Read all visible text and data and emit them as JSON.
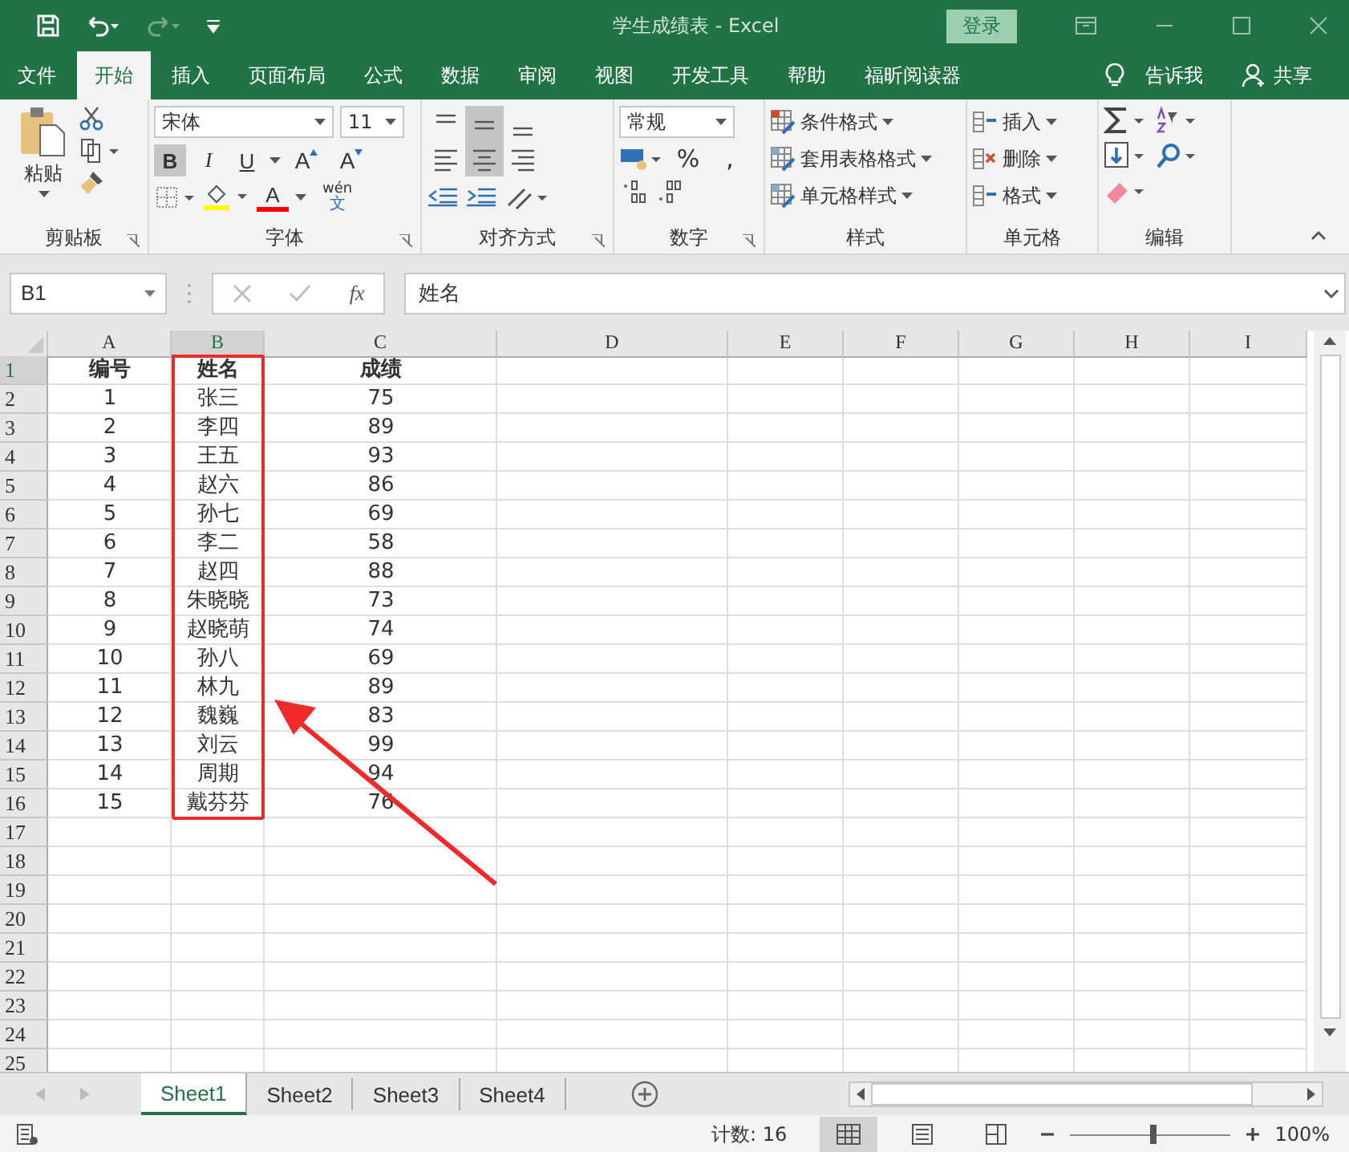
{
  "title_bar": {
    "title": "学生成绩表  -  Excel",
    "login": "登录"
  },
  "menu_tabs": [
    {
      "label": "文件",
      "selected": false
    },
    {
      "label": "开始",
      "selected": true
    },
    {
      "label": "插入",
      "selected": false
    },
    {
      "label": "页面布局",
      "selected": false
    },
    {
      "label": "公式",
      "selected": false
    },
    {
      "label": "数据",
      "selected": false
    },
    {
      "label": "审阅",
      "selected": false
    },
    {
      "label": "视图",
      "selected": false
    },
    {
      "label": "开发工具",
      "selected": false
    },
    {
      "label": "帮助",
      "selected": false
    },
    {
      "label": "福昕阅读器",
      "selected": false
    }
  ],
  "tell_me": "告诉我",
  "share": "共享",
  "ribbon": {
    "clipboard": {
      "paste": "粘贴",
      "label": "剪贴板"
    },
    "font": {
      "font_name": "宋体",
      "font_size": "11",
      "buttons": [
        {
          "label": "B",
          "pressed": true
        },
        {
          "label": "I",
          "pressed": false
        },
        {
          "label": "U",
          "pressed": false
        }
      ],
      "grow": "A",
      "shrink": "A",
      "font_color_letter": "A",
      "phonetic": "wén",
      "phonetic_char": "文",
      "label": "字体"
    },
    "alignment": {
      "buttons": [
        {
          "kind": "top",
          "pressed": false
        },
        {
          "kind": "middle",
          "pressed": true
        },
        {
          "kind": "bottom",
          "pressed": false
        },
        {
          "kind": "left",
          "pressed": false
        },
        {
          "kind": "center",
          "pressed": true
        },
        {
          "kind": "right",
          "pressed": false
        }
      ],
      "label": "对齐方式"
    },
    "number": {
      "format": "常规",
      "percent": "%",
      "comma": ",",
      "label": "数字"
    },
    "styles": {
      "items": [
        "条件格式",
        "套用表格格式",
        "单元格样式"
      ],
      "label": "样式"
    },
    "cells": {
      "items": [
        "插入",
        "删除",
        "格式"
      ],
      "label": "单元格"
    },
    "editing": {
      "label": "编辑"
    }
  },
  "formula_bar": {
    "name_box": "B1",
    "fx": "fx",
    "value": "姓名"
  },
  "sheet": {
    "columns": [
      {
        "label": "A",
        "selected": false
      },
      {
        "label": "B",
        "selected": true
      },
      {
        "label": "C",
        "selected": false
      },
      {
        "label": "D",
        "selected": false
      },
      {
        "label": "E",
        "selected": false
      },
      {
        "label": "F",
        "selected": false
      },
      {
        "label": "G",
        "selected": false
      },
      {
        "label": "H",
        "selected": false
      },
      {
        "label": "I",
        "selected": false
      }
    ],
    "rows": [
      {
        "number": "1",
        "selected": true,
        "bold": true,
        "cells": [
          "编号",
          "姓名",
          "成绩"
        ]
      },
      {
        "number": "2",
        "selected": false,
        "bold": false,
        "cells": [
          "1",
          "张三",
          "75"
        ]
      },
      {
        "number": "3",
        "selected": false,
        "bold": false,
        "cells": [
          "2",
          "李四",
          "89"
        ]
      },
      {
        "number": "4",
        "selected": false,
        "bold": false,
        "cells": [
          "3",
          "王五",
          "93"
        ]
      },
      {
        "number": "5",
        "selected": false,
        "bold": false,
        "cells": [
          "4",
          "赵六",
          "86"
        ]
      },
      {
        "number": "6",
        "selected": false,
        "bold": false,
        "cells": [
          "5",
          "孙七",
          "69"
        ]
      },
      {
        "number": "7",
        "selected": false,
        "bold": false,
        "cells": [
          "6",
          "李二",
          "58"
        ]
      },
      {
        "number": "8",
        "selected": false,
        "bold": false,
        "cells": [
          "7",
          "赵四",
          "88"
        ]
      },
      {
        "number": "9",
        "selected": false,
        "bold": false,
        "cells": [
          "8",
          "朱晓晓",
          "73"
        ]
      },
      {
        "number": "10",
        "selected": false,
        "bold": false,
        "cells": [
          "9",
          "赵晓萌",
          "74"
        ]
      },
      {
        "number": "11",
        "selected": false,
        "bold": false,
        "cells": [
          "10",
          "孙八",
          "69"
        ]
      },
      {
        "number": "12",
        "selected": false,
        "bold": false,
        "cells": [
          "11",
          "林九",
          "89"
        ]
      },
      {
        "number": "13",
        "selected": false,
        "bold": false,
        "cells": [
          "12",
          "魏巍",
          "83"
        ]
      },
      {
        "number": "14",
        "selected": false,
        "bold": false,
        "cells": [
          "13",
          "刘云",
          "99"
        ]
      },
      {
        "number": "15",
        "selected": false,
        "bold": false,
        "cells": [
          "14",
          "周期",
          "94"
        ]
      },
      {
        "number": "16",
        "selected": false,
        "bold": false,
        "cells": [
          "15",
          "戴芬芬",
          "76"
        ]
      },
      {
        "number": "17",
        "selected": false
      },
      {
        "number": "18",
        "selected": false
      },
      {
        "number": "19",
        "selected": false
      },
      {
        "number": "20",
        "selected": false
      },
      {
        "number": "21",
        "selected": false
      },
      {
        "number": "22",
        "selected": false
      },
      {
        "number": "23",
        "selected": false
      },
      {
        "number": "24",
        "selected": false
      },
      {
        "number": "25",
        "selected": false
      }
    ]
  },
  "sheet_tabs": [
    {
      "label": "Sheet1",
      "selected": true
    },
    {
      "label": "Sheet2",
      "selected": false
    },
    {
      "label": "Sheet3",
      "selected": false
    },
    {
      "label": "Sheet4",
      "selected": false
    }
  ],
  "status_bar": {
    "count": "计数: 16",
    "views": [
      {
        "kind": "normal",
        "selected": true
      },
      {
        "kind": "page_layout",
        "selected": false
      },
      {
        "kind": "page_break",
        "selected": false
      }
    ],
    "zoom_slider": {
      "level": 0.52
    },
    "zoom": "100%"
  }
}
